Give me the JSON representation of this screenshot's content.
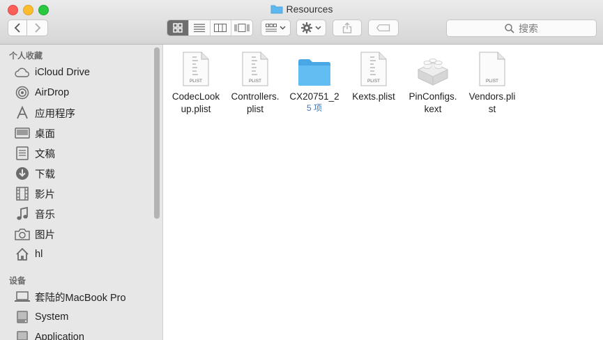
{
  "window": {
    "title": "Resources"
  },
  "search": {
    "placeholder": "搜索"
  },
  "sidebar": {
    "favorites_header": "个人收藏",
    "favorites": [
      {
        "label": "iCloud Drive",
        "icon": "cloud-icon"
      },
      {
        "label": "AirDrop",
        "icon": "airdrop-icon"
      },
      {
        "label": "应用程序",
        "icon": "applications-icon"
      },
      {
        "label": "桌面",
        "icon": "desktop-icon"
      },
      {
        "label": "文稿",
        "icon": "documents-icon"
      },
      {
        "label": "下载",
        "icon": "downloads-icon"
      },
      {
        "label": "影片",
        "icon": "movies-icon"
      },
      {
        "label": "音乐",
        "icon": "music-icon"
      },
      {
        "label": "图片",
        "icon": "pictures-icon"
      },
      {
        "label": "hl",
        "icon": "home-icon"
      }
    ],
    "devices_header": "设备",
    "devices": [
      {
        "label": "套陆的MacBook Pro",
        "icon": "laptop-icon"
      },
      {
        "label": "System",
        "icon": "disk-icon"
      },
      {
        "label": "Application",
        "icon": "disk-icon"
      }
    ]
  },
  "files": [
    {
      "name": "CodecLook\nup.plist",
      "badge": "PLIST",
      "kind": "plist",
      "sub": ""
    },
    {
      "name": "Controllers.\nplist",
      "badge": "PLIST",
      "kind": "plist",
      "sub": ""
    },
    {
      "name": "CX20751_2",
      "badge": "",
      "kind": "folder",
      "sub": "5 项"
    },
    {
      "name": "Kexts.plist",
      "badge": "PLIST",
      "kind": "plist",
      "sub": ""
    },
    {
      "name": "PinConfigs.\nkext",
      "badge": "",
      "kind": "kext",
      "sub": ""
    },
    {
      "name": "Vendors.pli\nst",
      "badge": "PLIST",
      "kind": "plist",
      "sub": ""
    }
  ],
  "colors": {
    "folder": "#5fb7ef",
    "accent": "#3b78c4",
    "sidebar_bg": "#e7e7e7"
  }
}
